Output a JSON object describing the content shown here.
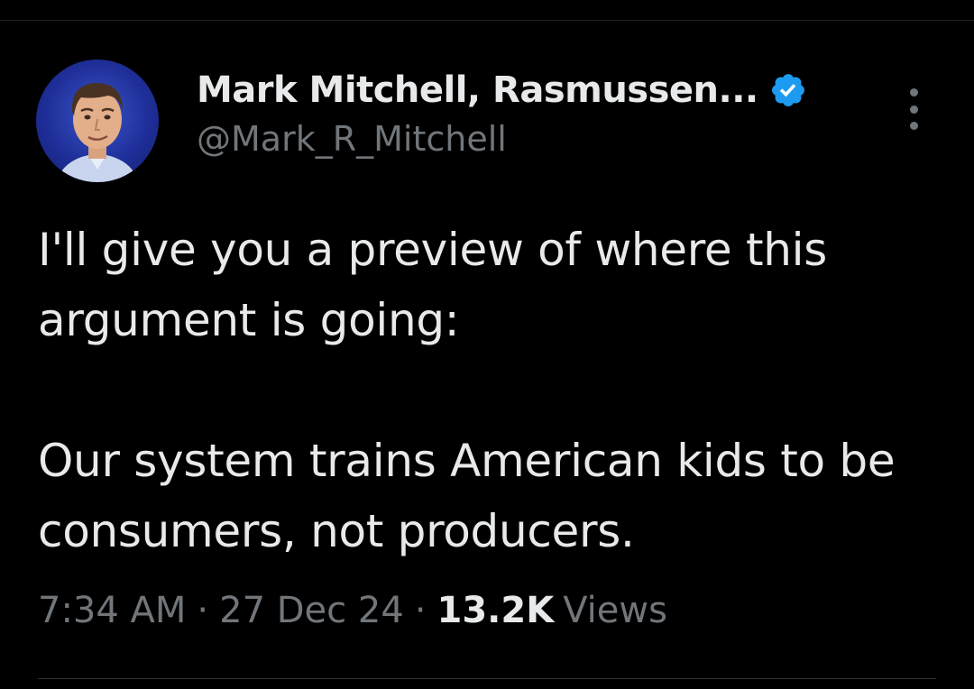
{
  "tweet": {
    "author": {
      "display_name": "Mark Mitchell, Rasmussen...",
      "handle": "@Mark_R_Mitchell",
      "verified": true
    },
    "paragraphs": [
      "I'll give you a preview of where this argument is going:",
      "Our system trains American kids to be consumers, not producers."
    ],
    "time": "7:34 AM",
    "date": "27 Dec 24",
    "separator": "·",
    "views_count": "13.2K",
    "views_label": "Views"
  },
  "icons": {
    "verified": "verified-badge-icon",
    "more": "more-options-icon"
  },
  "colors": {
    "background": "#000000",
    "primary_text": "#e7e9ea",
    "secondary_text": "#71767b",
    "verified_blue": "#1d9bf0",
    "divider": "#2f3336"
  }
}
